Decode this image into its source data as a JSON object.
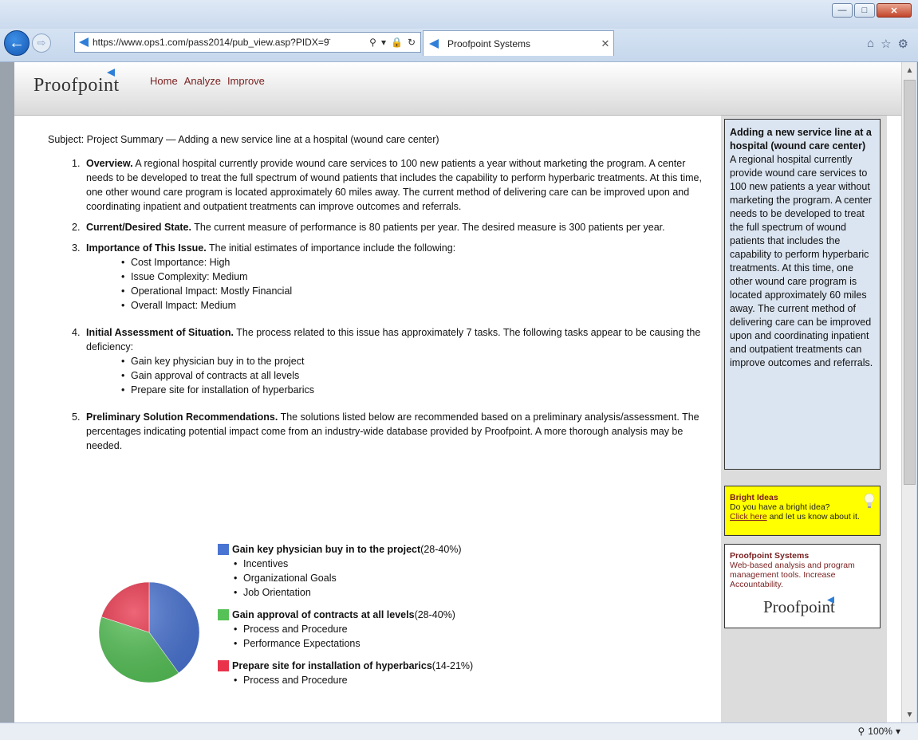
{
  "browser": {
    "url": "https://www.ops1.com/pass2014/pub_view.asp?PIDX=9̈",
    "tab_title": "Proofpoint Systems",
    "zoom_label": "100%"
  },
  "site": {
    "logo_text": "Proofpoint",
    "nav": [
      "Home",
      "Analyze",
      "Improve"
    ]
  },
  "main": {
    "subject": "Subject: Project Summary — Adding a new service line at a hospital (wound care center)",
    "items": [
      {
        "num": "1.",
        "title": "Overview.",
        "text": " A regional hospital currently provide wound care services to 100 new patients a year without marketing the program. A center needs to be developed to treat the full spectrum of wound patients that includes the capability to perform hyperbaric treatments. At this time, one other wound care program is located approximately 60 miles away. The current method of delivering care can be improved upon and coordinating inpatient and outpatient treatments can improve outcomes and referrals."
      },
      {
        "num": "2.",
        "title": "Current/Desired State.",
        "text": " The current measure of performance is 80 patients per year. The desired measure is 300 patients per year."
      },
      {
        "num": "3.",
        "title": "Importance of This Issue.",
        "text": " The initial estimates of importance include the following:",
        "bullets": [
          "Cost Importance: High",
          "Issue Complexity: Medium",
          "Operational Impact: Mostly Financial",
          "Overall Impact: Medium"
        ]
      },
      {
        "num": "4.",
        "title": "Initial Assessment of Situation.",
        "text": " The process related to this issue has approximately 7 tasks. The following tasks appear to be causing the deficiency:",
        "bullets": [
          "Gain key physician buy in to the project",
          "Gain approval of contracts at all levels",
          "Prepare site for installation of hyperbarics"
        ]
      },
      {
        "num": "5.",
        "title": "Preliminary Solution Recommendations.",
        "text": " The solutions listed below are recommended based on a preliminary analysis/assessment. The percentages indicating potential impact come from an industry-wide database provided by Proofpoint. A more thorough analysis may be needed."
      }
    ],
    "solutions": [
      {
        "title": "Gain key physician buy in to the project",
        "range": " (28-40%)",
        "color": "#4a74d2",
        "bullets": [
          "Incentives",
          "Organizational Goals",
          "Job Orientation"
        ]
      },
      {
        "title": "Gain approval of contracts at all levels",
        "range": " (28-40%)",
        "color": "#56c157",
        "bullets": [
          "Process and Procedure",
          "Performance Expectations"
        ]
      },
      {
        "title": "Prepare site for installation of hyperbarics",
        "range": " (14-21%)",
        "color": "#e8334a",
        "bullets": [
          "Process and Procedure"
        ]
      }
    ]
  },
  "sidebar": {
    "summary_title": "Adding a new service line at a hospital (wound care center)",
    "summary_text": "A regional hospital currently provide wound care services to 100 new patients a year without marketing the program. A center needs to be developed to treat the full spectrum of wound patients that includes the capability to perform hyperbaric treatments. At this time, one other wound care program is located approximately 60 miles away. The current method of delivering care can be improved upon and coordinating inpatient and outpatient treatments can improve outcomes and referrals.",
    "bright_title": "Bright Ideas",
    "bright_line1": "Do you have a bright idea?",
    "bright_link": "Click here",
    "bright_rest": " and let us know about it.",
    "systems_title": "Proofpoint Systems",
    "systems_text": "Web-based analysis and program management tools. Increase Accountability.",
    "systems_logo": "Proofpoint"
  },
  "chart_data": {
    "type": "pie",
    "series": [
      {
        "name": "Gain key physician buy in to the project",
        "value": 40,
        "color": "#4a74d2"
      },
      {
        "name": "Gain approval of contracts at all levels",
        "value": 40,
        "color": "#56c157"
      },
      {
        "name": "Prepare site for installation of hyperbarics",
        "value": 20,
        "color": "#e8334a"
      }
    ]
  }
}
